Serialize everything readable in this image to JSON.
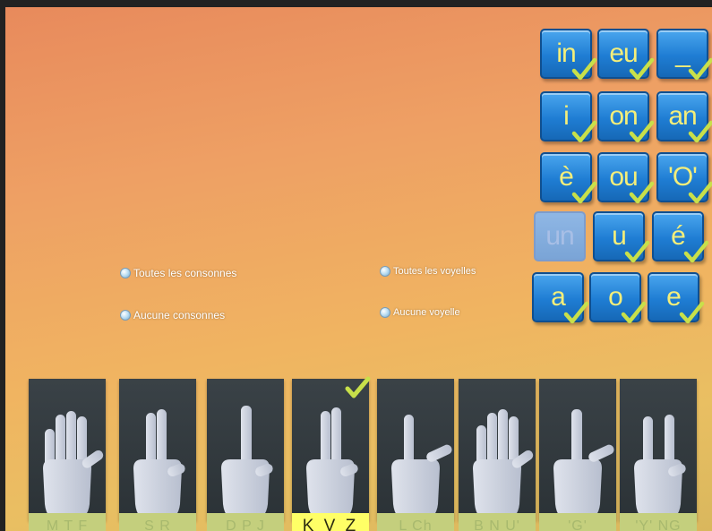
{
  "vowels": [
    {
      "label": "in",
      "checked": true,
      "enabled": true
    },
    {
      "label": "eu",
      "checked": true,
      "enabled": true
    },
    {
      "label": "_",
      "checked": true,
      "enabled": true
    },
    {
      "label": "i",
      "checked": true,
      "enabled": true
    },
    {
      "label": "on",
      "checked": true,
      "enabled": true
    },
    {
      "label": "an",
      "checked": true,
      "enabled": true
    },
    {
      "label": "è",
      "checked": true,
      "enabled": true
    },
    {
      "label": "ou",
      "checked": true,
      "enabled": true
    },
    {
      "label": "'O'",
      "checked": true,
      "enabled": true
    },
    {
      "label": "un",
      "checked": false,
      "enabled": false
    },
    {
      "label": "u",
      "checked": true,
      "enabled": true
    },
    {
      "label": "é",
      "checked": true,
      "enabled": true
    },
    {
      "label": "a",
      "checked": true,
      "enabled": true
    },
    {
      "label": "o",
      "checked": true,
      "enabled": true
    },
    {
      "label": "e",
      "checked": true,
      "enabled": true
    }
  ],
  "options": {
    "all_consonants": "Toutes les consonnes",
    "no_consonants": "Aucune consonnes",
    "all_vowels": "Toutes les voyelles",
    "no_vowels": "Aucune voyelle"
  },
  "hand_cards": [
    {
      "label": "M T F",
      "selected": false
    },
    {
      "label": "S R",
      "selected": false
    },
    {
      "label": "D P J",
      "selected": false
    },
    {
      "label": "K V Z",
      "selected": true
    },
    {
      "label": "L Ch",
      "selected": false
    },
    {
      "label": "B N U'",
      "selected": false
    },
    {
      "label": "'G'",
      "selected": false
    },
    {
      "label": "'Y' NG",
      "selected": false
    }
  ],
  "colors": {
    "tile_blue": "#1f7dd3",
    "tile_text": "#f4ee7a",
    "check": "#c8e04a",
    "selected_label": "#ffff66"
  }
}
